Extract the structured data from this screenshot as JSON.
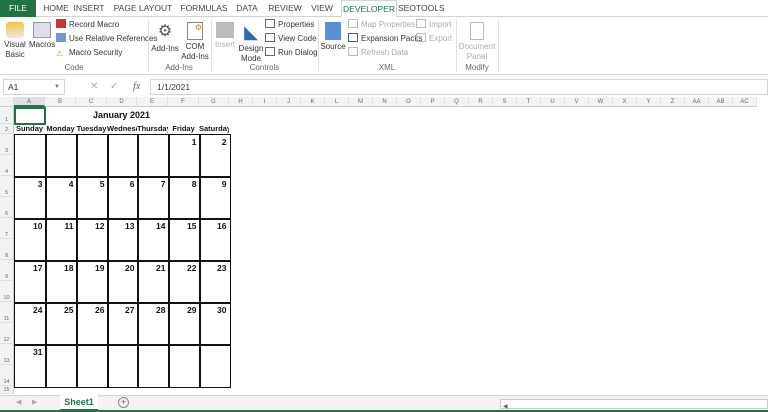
{
  "ribbon_tabs": [
    "FILE",
    "HOME",
    "INSERT",
    "PAGE LAYOUT",
    "FORMULAS",
    "DATA",
    "REVIEW",
    "VIEW",
    "DEVELOPER",
    "SEOTOOLS"
  ],
  "active_tab": "DEVELOPER",
  "groups": {
    "code": {
      "label": "Code",
      "visual_basic": "Visual Basic",
      "macros": "Macros",
      "record_macro": "Record Macro",
      "relative_refs": "Use Relative References",
      "macro_security": "Macro Security"
    },
    "addins": {
      "label": "Add-Ins",
      "addins": "Add-Ins",
      "com_addins": "COM Add-Ins"
    },
    "controls": {
      "label": "Controls",
      "insert": "Insert",
      "design_mode": "Design Mode",
      "properties": "Properties",
      "view_code": "View Code",
      "run_dialog": "Run Dialog"
    },
    "xml": {
      "label": "XML",
      "source": "Source",
      "map_properties": "Map Properties",
      "expansion_packs": "Expansion Packs",
      "refresh_data": "Refresh Data",
      "import": "Import",
      "export": "Export"
    },
    "modify": {
      "label": "Modify",
      "document_panel": "Document Panel"
    }
  },
  "formula_bar": {
    "name_box": "A1",
    "formula": "1/1/2021",
    "fx": "fx"
  },
  "columns": [
    "A",
    "B",
    "C",
    "D",
    "E",
    "F",
    "G",
    "H",
    "I",
    "J",
    "K",
    "L",
    "M",
    "N",
    "O",
    "P",
    "Q",
    "R",
    "S",
    "T",
    "U",
    "V",
    "W",
    "X",
    "Y",
    "Z",
    "AA",
    "AB",
    "AC"
  ],
  "rows": [
    "1",
    "2",
    "3",
    "4",
    "5",
    "6",
    "7",
    "8",
    "9",
    "10",
    "11",
    "12",
    "13",
    "14",
    "15"
  ],
  "calendar": {
    "title": "January 2021",
    "days": [
      "Sunday",
      "Monday",
      "Tuesday",
      "Wednesday",
      "Thursday",
      "Friday",
      "Saturday"
    ],
    "weeks": [
      [
        "",
        "",
        "",
        "",
        "",
        "1",
        "2"
      ],
      [
        "3",
        "4",
        "5",
        "6",
        "7",
        "8",
        "9"
      ],
      [
        "10",
        "11",
        "12",
        "13",
        "14",
        "15",
        "16"
      ],
      [
        "17",
        "18",
        "19",
        "20",
        "21",
        "22",
        "23"
      ],
      [
        "24",
        "25",
        "26",
        "27",
        "28",
        "29",
        "30"
      ],
      [
        "31",
        "",
        "",
        "",
        "",
        "",
        ""
      ]
    ]
  },
  "sheet_tabs": [
    "Sheet1"
  ],
  "colors": {
    "accent": "#217346"
  }
}
